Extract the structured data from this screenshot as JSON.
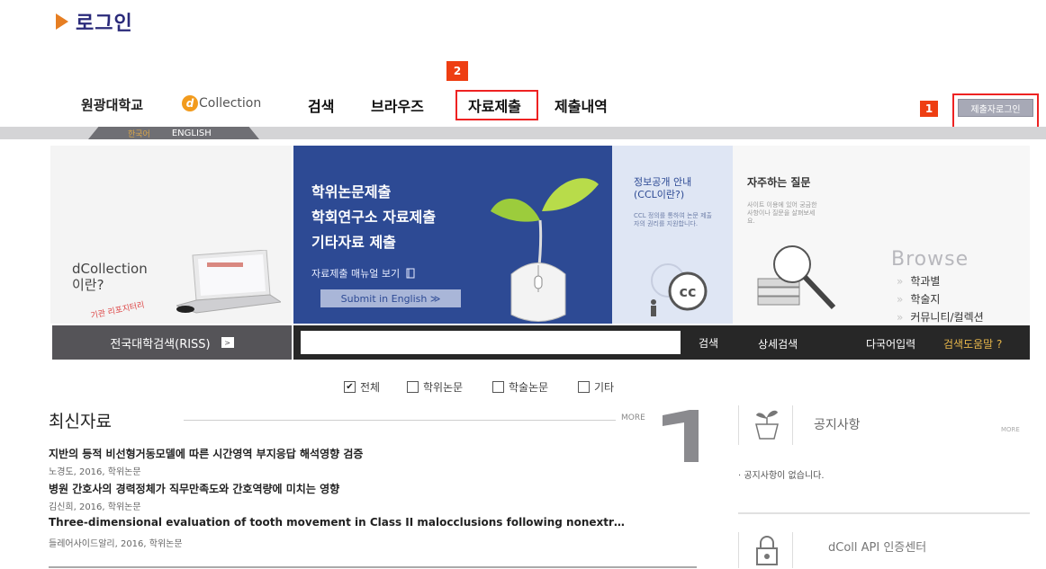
{
  "heading": "로그인",
  "markers": {
    "one": "1",
    "two": "2"
  },
  "nav": {
    "university": "원광대학교",
    "logo_letter": "d",
    "logo_text": "Collection",
    "links": [
      "검색",
      "브라우즈",
      "자료제출",
      "제출내역"
    ],
    "login_button": "제출자로그인"
  },
  "lang": {
    "korean": "한국어",
    "english": "ENGLISH"
  },
  "banner": {
    "intro_title": "dCollection",
    "intro_sub": "이란?",
    "intro_hand": "기관 리포지터리",
    "submit_lines": [
      "학위논문제출",
      "학회연구소 자료제출",
      "기타자료 제출"
    ],
    "manual_link": "자료제출 매뉴얼 보기",
    "english_button": "Submit in English  ≫",
    "ccl_title": "정보공개 안내",
    "ccl_title2": "(CCL이란?)",
    "ccl_sub": "CCL 정의를 통하여 논문 제출자의 권리를 지원합니다.",
    "ccl_icon": "cc",
    "faq_title": "자주하는 질문",
    "faq_sub": "사이트 이용에 있어 궁금한 사항이나 질문을 살펴보세요.",
    "browse_title": "Browse",
    "browse_items": [
      "학과별",
      "학술지",
      "커뮤니티/컬렉션"
    ]
  },
  "search": {
    "riss": "전국대학검색(RISS)",
    "riss_arrow": ">",
    "input_value": "",
    "search_button": "검색",
    "advanced": "상세검색",
    "multilang": "다국어입력",
    "help": "검색도움말 ?",
    "filters": [
      {
        "label": "전체",
        "checked": true
      },
      {
        "label": "학위논문",
        "checked": false
      },
      {
        "label": "학술논문",
        "checked": false
      },
      {
        "label": "기타",
        "checked": false
      }
    ]
  },
  "latest": {
    "title": "최신자료",
    "more": "MORE",
    "items": [
      {
        "title": "지반의 등적 비선형거동모델에 따른 시간영역 부지응답 해석영향 검증",
        "meta": "노경도, 2016, 학위논문"
      },
      {
        "title": "병원 간호사의 경력정체가 직무만족도와 간호역량에 미치는 영향",
        "meta": "김신희, 2016, 학위논문"
      },
      {
        "title": "Three-dimensional evaluation of tooth movement in Class II malocclusions following nonextr…",
        "meta": "들레어사이드알리, 2016, 학위논문"
      }
    ]
  },
  "notice": {
    "title": "공지사항",
    "more": "MORE",
    "empty": "공지사항이 없습니다.",
    "icon": "plant-pot-icon"
  },
  "api": {
    "title": "dColl API 인증센터",
    "icon": "lock-icon"
  }
}
